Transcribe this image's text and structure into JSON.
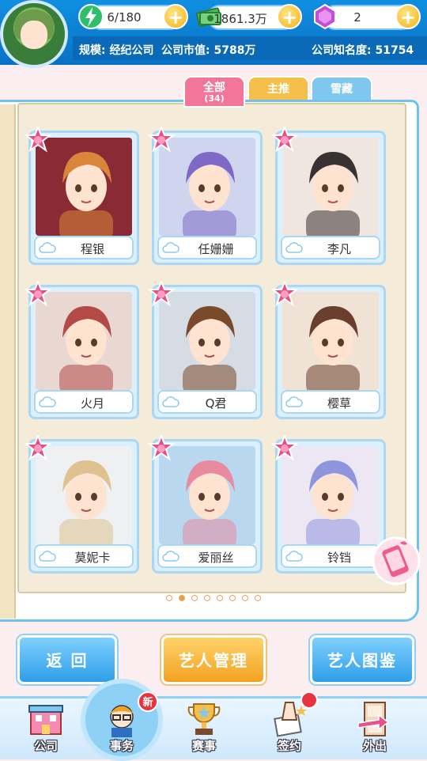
{
  "header": {
    "stamina": "6/180",
    "money": "1861.3万",
    "gems": "2",
    "scale": "规模: 经纪公司",
    "market_value": "公司市值: 5788万",
    "fame": "公司知名度: 51754"
  },
  "tabs": [
    {
      "label": "全部",
      "count": "(34)"
    },
    {
      "label": "主推"
    },
    {
      "label": "雪藏"
    }
  ],
  "artists": [
    {
      "name": "程银",
      "bg": "#8a2a34",
      "hair": "#d9863a"
    },
    {
      "name": "任姗姗",
      "bg": "#cfd4ef",
      "hair": "#7e6ac6"
    },
    {
      "name": "李凡",
      "bg": "#efe6df",
      "hair": "#3a3232"
    },
    {
      "name": "火月",
      "bg": "#e9d8d2",
      "hair": "#b24a45"
    },
    {
      "name": "Q君",
      "bg": "#d6dce3",
      "hair": "#7a4a2c"
    },
    {
      "name": "樱草",
      "bg": "#f1e2d6",
      "hair": "#6a3f2e"
    },
    {
      "name": "莫妮卡",
      "bg": "#eef0f2",
      "hair": "#dfc28f"
    },
    {
      "name": "爱丽丝",
      "bg": "#b9d8ef",
      "hair": "#e88aa0"
    },
    {
      "name": "铃铛",
      "bg": "#ede7f4",
      "hair": "#8e95dc"
    }
  ],
  "pagination": {
    "total": 8,
    "current": 2
  },
  "buttons": {
    "back": "返 回",
    "manage": "艺人管理",
    "catalog": "艺人图鉴"
  },
  "nav": [
    {
      "label": "公司"
    },
    {
      "label": "事务",
      "badge": "新"
    },
    {
      "label": "赛事"
    },
    {
      "label": "签约"
    },
    {
      "label": "外出"
    }
  ],
  "colors": {
    "primary_blue": "#0a72c6",
    "tab_pink": "#f1769a",
    "tab_yellow": "#f4c04b",
    "tab_blue": "#7ec8f0",
    "orange_btn": "#f2a222"
  },
  "icons": {
    "stamina": "lightning-icon",
    "money": "cash-icon",
    "gem": "gem-icon",
    "plus": "plus-icon"
  }
}
